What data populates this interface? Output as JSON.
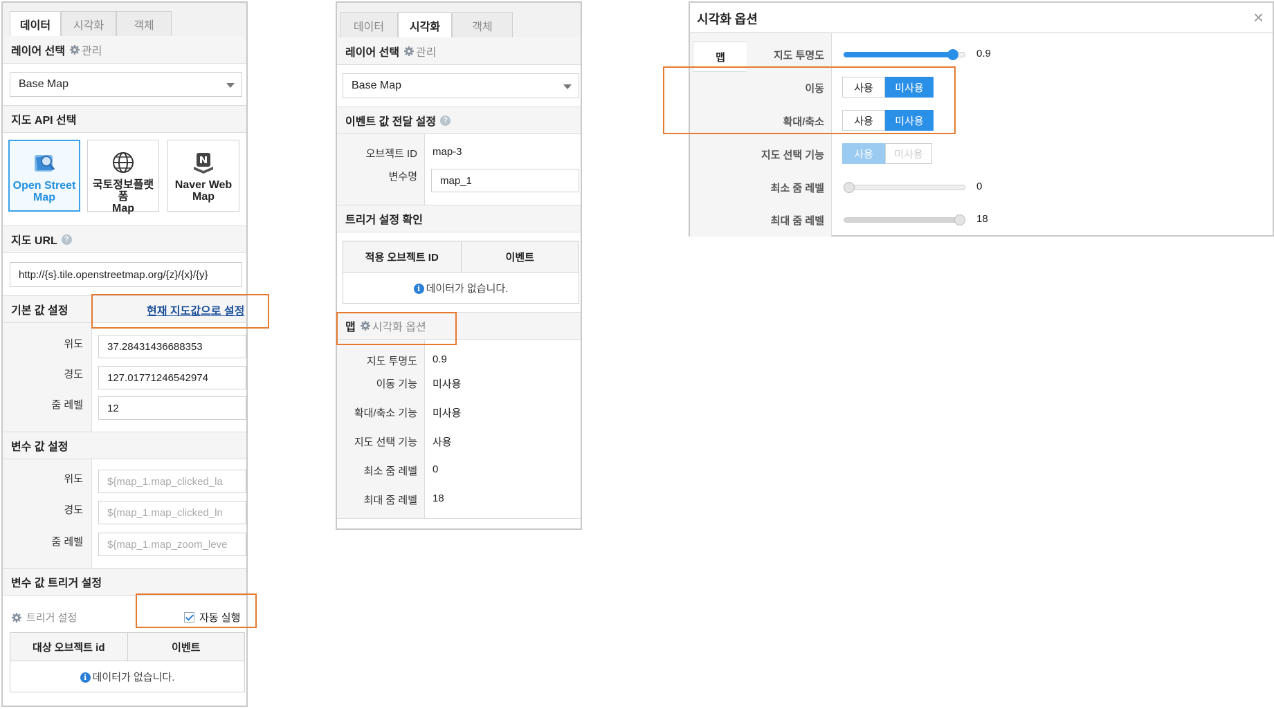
{
  "panel1": {
    "tabs": [
      "데이터",
      "시각화",
      "객체"
    ],
    "layer_select": {
      "title": "레이어 선택",
      "manage": "관리",
      "value": "Base Map"
    },
    "map_api": {
      "title": "지도 API 선택",
      "cards": [
        {
          "line1": "Open Street",
          "line2": "Map",
          "icon": "openstreetmap-icon",
          "selected": true
        },
        {
          "line1": "국토정보플랫폼",
          "line2": "Map",
          "icon": "globe-icon",
          "selected": false
        },
        {
          "line1": "Naver Web",
          "line2": "Map",
          "icon": "naver-map-icon",
          "selected": false
        }
      ]
    },
    "map_url": {
      "title": "지도 URL",
      "value": "http://{s}.tile.openstreetmap.org/{z}/{x}/{y}"
    },
    "defaults": {
      "title": "기본 값 설정",
      "link": "현재 지도값으로 설정",
      "lat_label": "위도",
      "lat": "37.28431436688353",
      "lng_label": "경도",
      "lng": "127.01771246542974",
      "zoom_label": "줌 레벨",
      "zoom": "12"
    },
    "variables": {
      "title": "변수 값 설정",
      "lat_label": "위도",
      "lat_placeholder": "${map_1.map_clicked_la",
      "lng_label": "경도",
      "lng_placeholder": "${map_1.map_clicked_ln",
      "zoom_label": "줌 레벨",
      "zoom_placeholder": "${map_1.map_zoom_leve"
    },
    "trigger": {
      "title": "변수 값 트리거 설정",
      "setting": "트리거 설정",
      "auto_run": "자동 실행",
      "auto_run_checked": true,
      "col1": "대상 오브젝트 id",
      "col2": "이벤트",
      "empty": "데이터가 없습니다."
    }
  },
  "panel2": {
    "tabs": [
      "데이터",
      "시각화",
      "객체"
    ],
    "layer_select": {
      "title": "레이어 선택",
      "manage": "관리",
      "value": "Base Map"
    },
    "event": {
      "title": "이벤트 값 전달 설정",
      "object_id_label": "오브젝트 ID",
      "object_id": "map-3",
      "var_label": "변수명",
      "var": "map_1"
    },
    "trigger_check": {
      "title": "트리거 설정 확인",
      "col1": "적용 오브젝트 ID",
      "col2": "이벤트",
      "empty": "데이터가 없습니다."
    },
    "map": {
      "title": "맵",
      "options": "시각화 옵션",
      "rows": [
        {
          "label": "지도 투명도",
          "value": "0.9"
        },
        {
          "label": "이동 기능",
          "value": "미사용"
        },
        {
          "label": "확대/축소 기능",
          "value": "미사용"
        },
        {
          "label": "지도 선택 기능",
          "value": "사용"
        },
        {
          "label": "최소 줌 레벨",
          "value": "0"
        },
        {
          "label": "최대 줌 레벨",
          "value": "18"
        }
      ]
    }
  },
  "dialog": {
    "title": "시각화 옵션",
    "side_tab": "맵",
    "opacity": {
      "label": "지도 투명도",
      "value": "0.9",
      "fraction": 0.9
    },
    "move": {
      "label": "이동",
      "use": "사용",
      "unuse": "미사용",
      "selected": "unuse"
    },
    "zoom": {
      "label": "확대/축소",
      "use": "사용",
      "unuse": "미사용",
      "selected": "unuse"
    },
    "select": {
      "label": "지도 선택 기능",
      "use": "사용",
      "unuse": "미사용",
      "selected": "use",
      "disabled": true
    },
    "min_zoom": {
      "label": "최소 줌 레벨",
      "value": "0"
    },
    "max_zoom": {
      "label": "최대 줌 레벨",
      "value": "18"
    }
  },
  "colors": {
    "accent": "#2a8fe6",
    "highlight": "#e57a2f",
    "link": "#1a4f9a"
  }
}
